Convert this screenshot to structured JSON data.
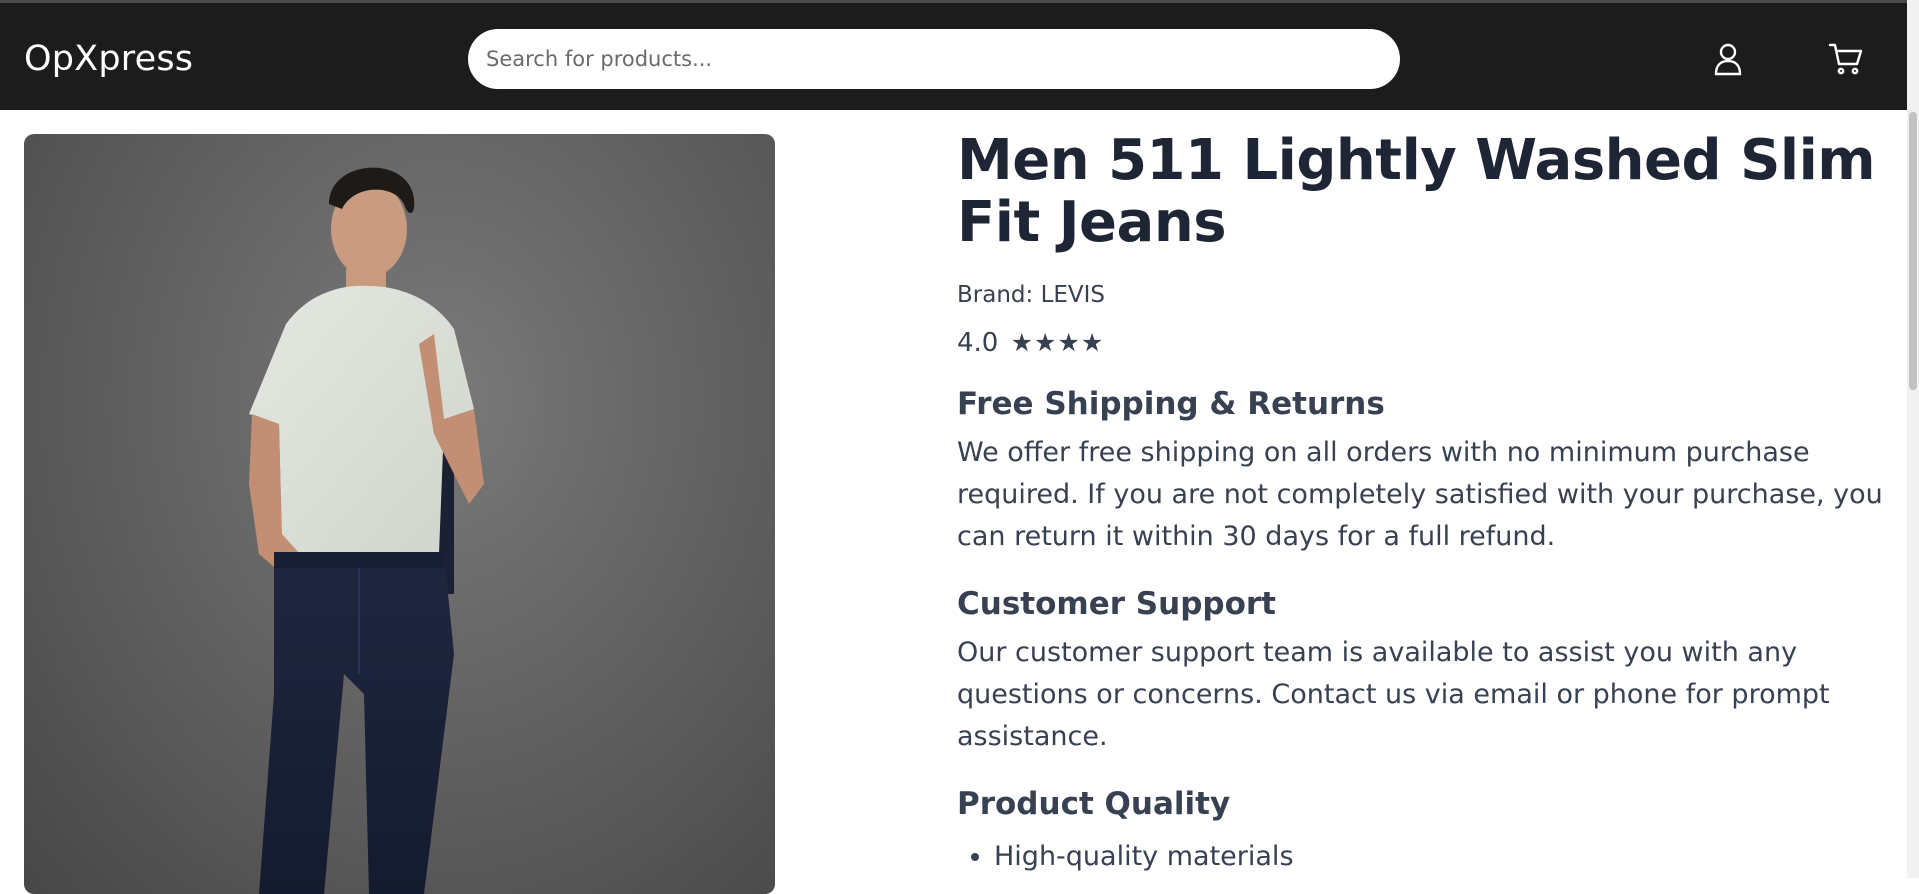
{
  "header": {
    "logo": "OpXpress",
    "search_placeholder": "Search for products...",
    "user_icon": "user-icon",
    "cart_icon": "cart-icon"
  },
  "product": {
    "title": "Men 511 Lightly Washed Slim Fit Jeans",
    "brand_label": "Brand: LEVIS",
    "rating_value": "4.0",
    "rating_stars": "★★★★",
    "rating": 4.0,
    "image_alt": "model wearing jeans"
  },
  "sections": {
    "shipping": {
      "title": "Free Shipping & Returns",
      "body": "We offer free shipping on all orders with no minimum purchase required. If you are not completely satisfied with your purchase, you can return it within 30 days for a full refund."
    },
    "support": {
      "title": "Customer Support",
      "body": "Our customer support team is available to assist you with any questions or concerns. Contact us via email or phone for prompt assistance."
    },
    "quality": {
      "title": "Product Quality",
      "items": [
        "High-quality materials"
      ]
    }
  },
  "colors": {
    "header_bg": "#1c1c1c",
    "title_text": "#1e2535",
    "body_text": "#374151"
  }
}
